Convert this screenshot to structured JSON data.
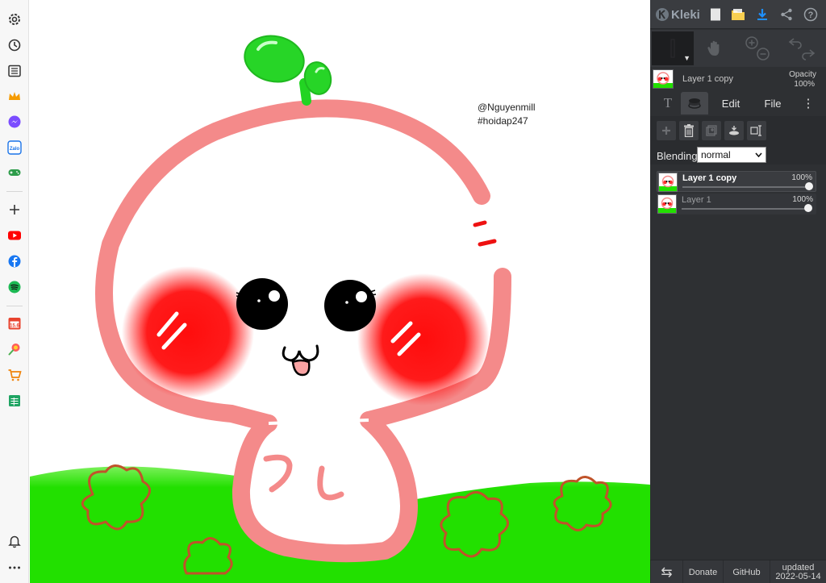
{
  "browser_rail": {
    "top_items": [
      "settings-icon",
      "history-icon",
      "reading-list-icon",
      "crown-icon",
      "messenger-icon",
      "zalo-icon",
      "gamepad-icon"
    ],
    "add_item": "plus-icon",
    "app_items": [
      "youtube-icon",
      "facebook-icon",
      "spotify-icon",
      "calendar-icon",
      "lollipop-icon",
      "cart-icon",
      "sheet-icon"
    ],
    "calendar_day": "15.6",
    "zalo_label": "Zalo",
    "bottom_items": [
      "bell-icon",
      "more-dots-icon"
    ]
  },
  "canvas": {
    "credit_handle": "@Nguyenmill",
    "credit_tag": "#hoidap247"
  },
  "kleki": {
    "app_name": "Kleki",
    "top_icons": [
      "new-file-icon",
      "open-folder-icon",
      "download-icon",
      "share-icon",
      "help-icon"
    ],
    "help_glyph": "?",
    "tools": [
      "brush-icon",
      "hand-icon",
      "zoom-icon",
      "undo-icon"
    ],
    "active_layer": {
      "name": "Layer 1 copy",
      "opacity_label": "Opacity",
      "opacity_value": "100%"
    },
    "tabs": {
      "text_glyph": "T",
      "layers_icon": "layers-icon",
      "edit": "Edit",
      "file": "File",
      "more_glyph": "⋮"
    },
    "layer_tools": [
      "add-layer-icon",
      "delete-layer-icon",
      "duplicate-layer-icon",
      "merge-layer-icon",
      "rename-layer-icon"
    ],
    "blending": {
      "label": "Blending",
      "value": "normal"
    },
    "layers": [
      {
        "name": "Layer 1 copy",
        "opacity": "100%",
        "opacity_level": 1.0,
        "active": true
      },
      {
        "name": "Layer 1",
        "opacity": "100%",
        "opacity_level": 1.0,
        "active": false
      }
    ],
    "footer": {
      "swap_glyph": "⇆",
      "donate": "Donate",
      "github": "GitHub",
      "updated_label": "updated",
      "updated_date": "2022-05-14"
    }
  },
  "colors": {
    "panel_bg": "#2e3033",
    "mushroom_outline": "#f48a8a",
    "cheek_red": "#ff1a1a",
    "sprout_green": "#22d422",
    "grass_green": "#22e000",
    "clover_brown": "#c0532a",
    "accent_blue": "#1e90ff"
  }
}
